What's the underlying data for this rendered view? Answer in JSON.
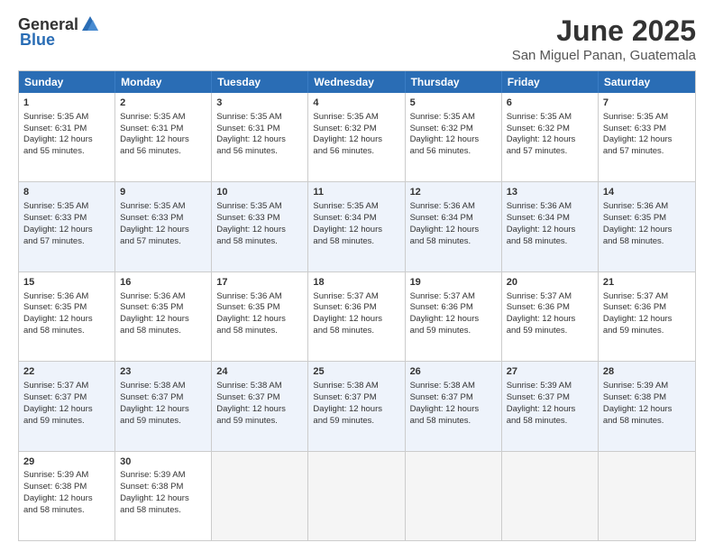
{
  "logo": {
    "general": "General",
    "blue": "Blue"
  },
  "title": "June 2025",
  "subtitle": "San Miguel Panan, Guatemala",
  "weekdays": [
    "Sunday",
    "Monday",
    "Tuesday",
    "Wednesday",
    "Thursday",
    "Friday",
    "Saturday"
  ],
  "weeks": [
    [
      {
        "day": 1,
        "info": "Sunrise: 5:35 AM\nSunset: 6:31 PM\nDaylight: 12 hours\nand 55 minutes."
      },
      {
        "day": 2,
        "info": "Sunrise: 5:35 AM\nSunset: 6:31 PM\nDaylight: 12 hours\nand 56 minutes."
      },
      {
        "day": 3,
        "info": "Sunrise: 5:35 AM\nSunset: 6:31 PM\nDaylight: 12 hours\nand 56 minutes."
      },
      {
        "day": 4,
        "info": "Sunrise: 5:35 AM\nSunset: 6:32 PM\nDaylight: 12 hours\nand 56 minutes."
      },
      {
        "day": 5,
        "info": "Sunrise: 5:35 AM\nSunset: 6:32 PM\nDaylight: 12 hours\nand 56 minutes."
      },
      {
        "day": 6,
        "info": "Sunrise: 5:35 AM\nSunset: 6:32 PM\nDaylight: 12 hours\nand 57 minutes."
      },
      {
        "day": 7,
        "info": "Sunrise: 5:35 AM\nSunset: 6:33 PM\nDaylight: 12 hours\nand 57 minutes."
      }
    ],
    [
      {
        "day": 8,
        "info": "Sunrise: 5:35 AM\nSunset: 6:33 PM\nDaylight: 12 hours\nand 57 minutes."
      },
      {
        "day": 9,
        "info": "Sunrise: 5:35 AM\nSunset: 6:33 PM\nDaylight: 12 hours\nand 57 minutes."
      },
      {
        "day": 10,
        "info": "Sunrise: 5:35 AM\nSunset: 6:33 PM\nDaylight: 12 hours\nand 58 minutes."
      },
      {
        "day": 11,
        "info": "Sunrise: 5:35 AM\nSunset: 6:34 PM\nDaylight: 12 hours\nand 58 minutes."
      },
      {
        "day": 12,
        "info": "Sunrise: 5:36 AM\nSunset: 6:34 PM\nDaylight: 12 hours\nand 58 minutes."
      },
      {
        "day": 13,
        "info": "Sunrise: 5:36 AM\nSunset: 6:34 PM\nDaylight: 12 hours\nand 58 minutes."
      },
      {
        "day": 14,
        "info": "Sunrise: 5:36 AM\nSunset: 6:35 PM\nDaylight: 12 hours\nand 58 minutes."
      }
    ],
    [
      {
        "day": 15,
        "info": "Sunrise: 5:36 AM\nSunset: 6:35 PM\nDaylight: 12 hours\nand 58 minutes."
      },
      {
        "day": 16,
        "info": "Sunrise: 5:36 AM\nSunset: 6:35 PM\nDaylight: 12 hours\nand 58 minutes."
      },
      {
        "day": 17,
        "info": "Sunrise: 5:36 AM\nSunset: 6:35 PM\nDaylight: 12 hours\nand 58 minutes."
      },
      {
        "day": 18,
        "info": "Sunrise: 5:37 AM\nSunset: 6:36 PM\nDaylight: 12 hours\nand 58 minutes."
      },
      {
        "day": 19,
        "info": "Sunrise: 5:37 AM\nSunset: 6:36 PM\nDaylight: 12 hours\nand 59 minutes."
      },
      {
        "day": 20,
        "info": "Sunrise: 5:37 AM\nSunset: 6:36 PM\nDaylight: 12 hours\nand 59 minutes."
      },
      {
        "day": 21,
        "info": "Sunrise: 5:37 AM\nSunset: 6:36 PM\nDaylight: 12 hours\nand 59 minutes."
      }
    ],
    [
      {
        "day": 22,
        "info": "Sunrise: 5:37 AM\nSunset: 6:37 PM\nDaylight: 12 hours\nand 59 minutes."
      },
      {
        "day": 23,
        "info": "Sunrise: 5:38 AM\nSunset: 6:37 PM\nDaylight: 12 hours\nand 59 minutes."
      },
      {
        "day": 24,
        "info": "Sunrise: 5:38 AM\nSunset: 6:37 PM\nDaylight: 12 hours\nand 59 minutes."
      },
      {
        "day": 25,
        "info": "Sunrise: 5:38 AM\nSunset: 6:37 PM\nDaylight: 12 hours\nand 59 minutes."
      },
      {
        "day": 26,
        "info": "Sunrise: 5:38 AM\nSunset: 6:37 PM\nDaylight: 12 hours\nand 58 minutes."
      },
      {
        "day": 27,
        "info": "Sunrise: 5:39 AM\nSunset: 6:37 PM\nDaylight: 12 hours\nand 58 minutes."
      },
      {
        "day": 28,
        "info": "Sunrise: 5:39 AM\nSunset: 6:38 PM\nDaylight: 12 hours\nand 58 minutes."
      }
    ],
    [
      {
        "day": 29,
        "info": "Sunrise: 5:39 AM\nSunset: 6:38 PM\nDaylight: 12 hours\nand 58 minutes."
      },
      {
        "day": 30,
        "info": "Sunrise: 5:39 AM\nSunset: 6:38 PM\nDaylight: 12 hours\nand 58 minutes."
      },
      null,
      null,
      null,
      null,
      null
    ]
  ]
}
